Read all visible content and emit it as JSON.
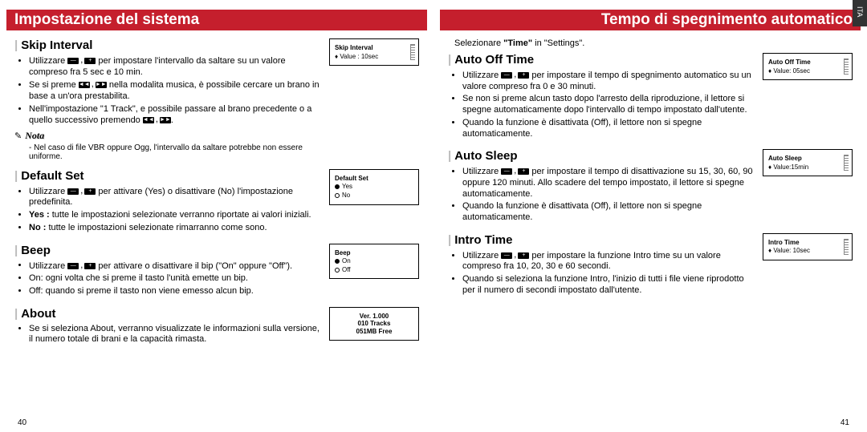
{
  "left": {
    "header": "Impostazione del sistema",
    "page_num": 40,
    "skip": {
      "title": "Skip Interval",
      "b1a": "Utilizzare ",
      "b1b": " per impostare l'intervallo da saltare su un valore compreso fra 5 sec e 10 min.",
      "b2a": "Se si preme ",
      "b2b": " nella modalita musica, è possibile cercare un brano in base a un'ora prestabilita.",
      "b3a": "Nell'impostazione \"1 Track\", e possibile passare al brano precedente o a quello successivo premendo ",
      "b3b": ".",
      "lcd_title": "Skip Interval",
      "lcd_value": "Value : 10sec",
      "note_label": "Nota",
      "note_text": "Nel caso di file VBR oppure Ogg, l'intervallo da saltare potrebbe non essere uniforme."
    },
    "default": {
      "title": "Default Set",
      "b1a": "Utilizzare ",
      "b1b": " per attivare (Yes) o disattivare (No) l'impostazione predefinita.",
      "b2_label": "Yes :",
      "b2": " tutte le impostazioni selezionate verranno riportate ai valori iniziali.",
      "b3_label": "No :",
      "b3": " tutte le impostazioni selezionate rimarranno come sono.",
      "lcd_title": "Default Set",
      "lcd_yes": "Yes",
      "lcd_no": "No"
    },
    "beep": {
      "title": "Beep",
      "b1a": "Utilizzare ",
      "b1b": " per attivare o disattivare il bip (\"On\" oppure \"Off\").",
      "b2": "On: ogni volta che si preme il tasto l'unità emette un bip.",
      "b3": "Off: quando si preme il tasto non viene emesso alcun bip.",
      "lcd_title": "Beep",
      "lcd_on": "On",
      "lcd_off": "Off"
    },
    "about": {
      "title": "About",
      "b1": "Se si seleziona About, verranno visualizzate le informazioni sulla versione, il numero totale di brani e la capacità rimasta.",
      "lcd_l1": "Ver.  1.000",
      "lcd_l2": "010 Tracks",
      "lcd_l3": "051MB Free"
    }
  },
  "right": {
    "header": "Tempo di spegnimento automatico",
    "page_num": 41,
    "tab": "ITA",
    "intro_a": "Selezionare ",
    "intro_bold": "\"Time\"",
    "intro_b": " in \"Settings\".",
    "autooff": {
      "title": "Auto Off Time",
      "b1a": "Utilizzare ",
      "b1b": " per impostare il tempo di spegnimento automatico su un valore compreso fra 0 e 30 minuti.",
      "b2": "Se non si preme alcun tasto dopo l'arresto della riproduzione, il lettore si spegne automaticamente dopo l'intervallo di tempo impostato dall'utente.",
      "b3": "Quando la funzione è disattivata (Off), il lettore non si spegne automaticamente.",
      "lcd_title": "Auto Off Time",
      "lcd_value": "Value: 05sec"
    },
    "autosleep": {
      "title": "Auto Sleep",
      "b1a": "Utilizzare ",
      "b1b": " per impostare il tempo di disattivazione su 15, 30, 60, 90 oppure 120 minuti. Allo scadere del tempo impostato, il lettore si spegne automaticamente.",
      "b2": "Quando la funzione è disattivata (Off), il lettore non si spegne automaticamente.",
      "lcd_title": "Auto Sleep",
      "lcd_value": "Value:15min"
    },
    "intro": {
      "title": "Intro Time",
      "b1a": "Utilizzare ",
      "b1b": " per impostare la funzione Intro time su un valore compreso fra 10, 20, 30 e 60 secondi.",
      "b2": "Quando si seleziona la funzione Intro, l'inizio di tutti i file viene riprodotto per il numero di secondi impostato dall'utente.",
      "lcd_title": "Intro Time",
      "lcd_value": "Value: 10sec"
    }
  }
}
